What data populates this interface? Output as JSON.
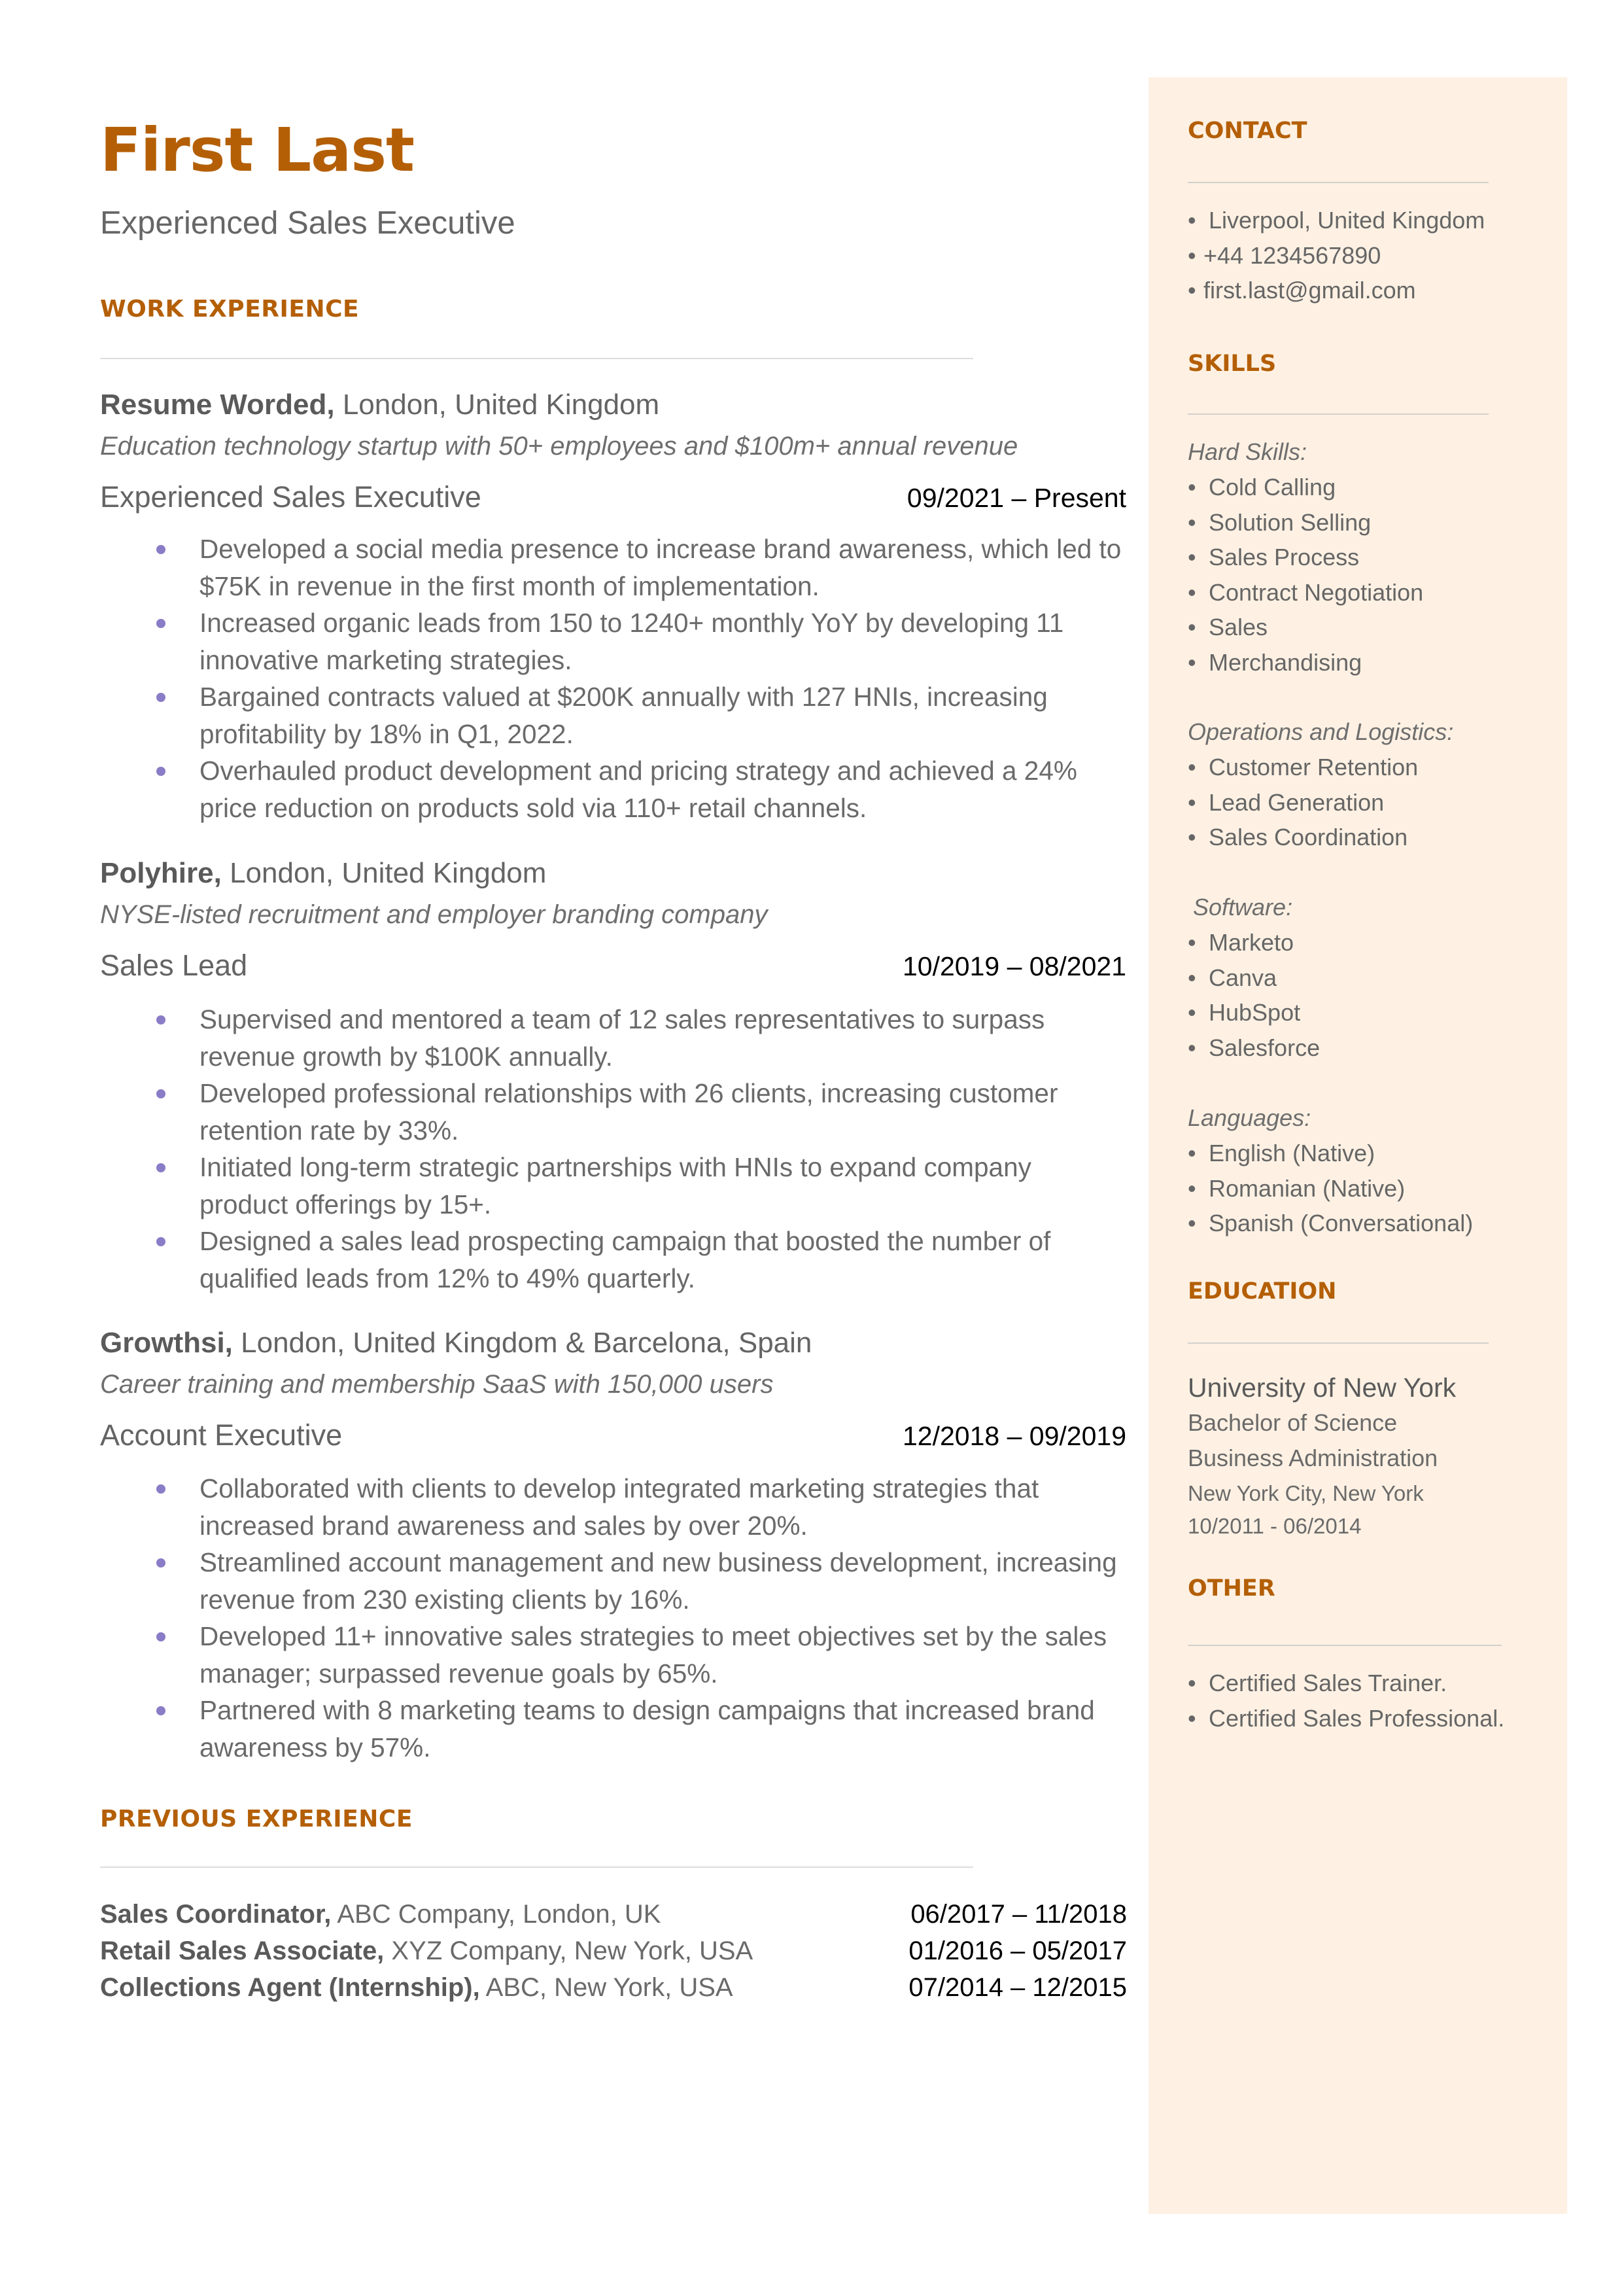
{
  "header": {
    "name": "First Last",
    "title": "Experienced Sales Executive"
  },
  "colors": {
    "accent": "#b45f06",
    "bullet": "#8a7cc6",
    "sidebar_bg": "#fef1e3",
    "text": "#666666"
  },
  "work_experience": {
    "heading": "WORK EXPERIENCE",
    "jobs": [
      {
        "company": "Resume Worded,",
        "location": " London, United Kingdom",
        "description": "Education technology startup with 50+ employees and $100m+ annual revenue",
        "role": "Experienced Sales Executive",
        "dates": "09/2021 – Present",
        "bullets": [
          "Developed a social media presence to increase brand awareness, which led to $75K in revenue in the first month of implementation.",
          "Increased organic leads from 150 to 1240+ monthly YoY by developing 11 innovative marketing strategies.",
          "Bargained contracts valued at $200K annually with 127 HNIs, increasing profitability by 18% in Q1, 2022.",
          "Overhauled product development and pricing strategy and achieved a 24% price reduction on products sold via 110+ retail channels."
        ]
      },
      {
        "company": "Polyhire,",
        "location": " London, United Kingdom",
        "description": "NYSE-listed recruitment and employer branding company",
        "role": "Sales Lead",
        "dates": "10/2019 – 08/2021",
        "bullets": [
          "Supervised and mentored a team of 12 sales representatives to surpass revenue growth by $100K annually.",
          "Developed professional relationships with 26 clients, increasing customer retention rate by 33%.",
          "Initiated long-term strategic partnerships with HNIs to expand company product offerings by 15+.",
          "Designed a sales lead prospecting campaign that boosted the number of qualified leads from 12% to 49% quarterly."
        ]
      },
      {
        "company": "Growthsi,",
        "location": " London, United Kingdom & Barcelona, Spain",
        "description": "Career training and membership SaaS with 150,000 users",
        "role": "Account Executive",
        "dates": "12/2018 – 09/2019",
        "bullets": [
          "Collaborated with clients to develop integrated marketing strategies that increased brand awareness and sales by over 20%.",
          "Streamlined account management and new business development, increasing revenue from 230 existing clients by 16%.",
          "Developed 11+ innovative sales strategies to meet objectives set by the sales manager; surpassed revenue goals by 65%.",
          "Partnered with 8 marketing teams to design campaigns that increased brand awareness by 57%."
        ]
      }
    ]
  },
  "previous_experience": {
    "heading": "PREVIOUS EXPERIENCE",
    "items": [
      {
        "role": "Sales Coordinator,",
        "details": " ABC Company, London, UK",
        "dates": "06/2017 – 11/2018"
      },
      {
        "role": "Retail Sales Associate,",
        "details": " XYZ Company, New York, USA",
        "dates": "01/2016 – 05/2017"
      },
      {
        "role": "Collections Agent (Internship),",
        "details": " ABC, New York, USA",
        "dates": "07/2014 – 12/2015"
      }
    ]
  },
  "sidebar": {
    "contact": {
      "heading": "CONTACT",
      "items": [
        "Liverpool, United Kingdom",
        "+44 1234567890",
        "first.last@gmail.com"
      ]
    },
    "skills": {
      "heading": "SKILLS",
      "groups": [
        {
          "label": "Hard Skills:",
          "items": [
            "Cold Calling",
            "Solution Selling",
            "Sales Process",
            "Contract Negotiation",
            "Sales",
            "Merchandising"
          ]
        },
        {
          "label": "Operations and Logistics:",
          "items": [
            "Customer Retention",
            "Lead Generation",
            "Sales Coordination"
          ]
        },
        {
          "label": "Software:",
          "items": [
            "Marketo",
            "Canva",
            "HubSpot",
            "Salesforce"
          ]
        },
        {
          "label": "Languages:",
          "items": [
            "English (Native)",
            "Romanian (Native)",
            "Spanish (Conversational)"
          ]
        }
      ]
    },
    "education": {
      "heading": "EDUCATION",
      "school": "University of New York",
      "degree": "Bachelor of Science",
      "field": "Business Administration",
      "location": "New York City, New York",
      "dates": "10/2011 - 06/2014"
    },
    "other": {
      "heading": "OTHER",
      "items": [
        "Certified Sales Trainer.",
        "Certified Sales Professional."
      ]
    }
  }
}
